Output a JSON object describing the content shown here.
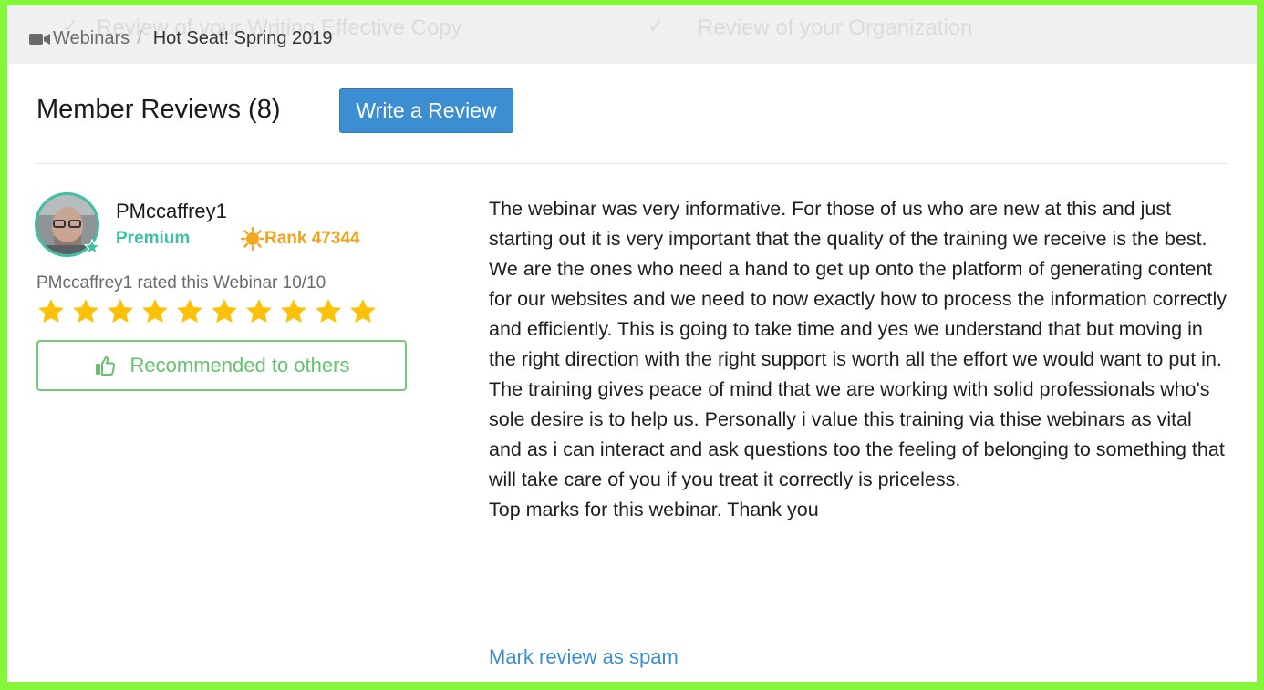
{
  "background_tabs": {
    "left_label": "Review of your Writing Effective Copy",
    "right_label": "Review of your Organization"
  },
  "breadcrumb": {
    "parent": "Webinars",
    "separator": "/",
    "current": "Hot Seat! Spring 2019",
    "icon": "video-camera-icon"
  },
  "reviews": {
    "title": "Member Reviews (8)",
    "write_button": "Write a Review"
  },
  "review": {
    "username": "PMccaffrey1",
    "membership": "Premium",
    "rank": "Rank 47344",
    "rated_text": "PMccaffrey1 rated this Webinar 10/10",
    "rating": 10,
    "rating_max": 10,
    "recommend_label": "Recommended to others",
    "body": [
      "The webinar was very informative. For those of us who are new at this and just starting out it is very important that the quality of the training we receive is the best.",
      "We are the ones who need a hand to get up onto the platform of generating content for our websites and we need to now exactly how to process the information correctly and efficiently. This is going to take time and yes we understand that but moving in the right direction with the right support is worth all the effort we would want to put in.",
      "The training gives peace of mind that we are working with solid professionals who's sole desire is to help us. Personally i value this training via thise webinars as vital and as i can interact and ask questions too the feeling of belonging to something that will take care of you if you treat it correctly is priceless.",
      "Top marks for this webinar. Thank you"
    ],
    "spam_link": "Mark review as spam"
  },
  "colors": {
    "frame": "#84f73a",
    "accent_blue": "#3a8ed1",
    "premium_teal": "#3fbfa4",
    "rank_orange": "#f0a21d",
    "star_yellow": "#ffc107",
    "recommend_green": "#67c06d"
  }
}
